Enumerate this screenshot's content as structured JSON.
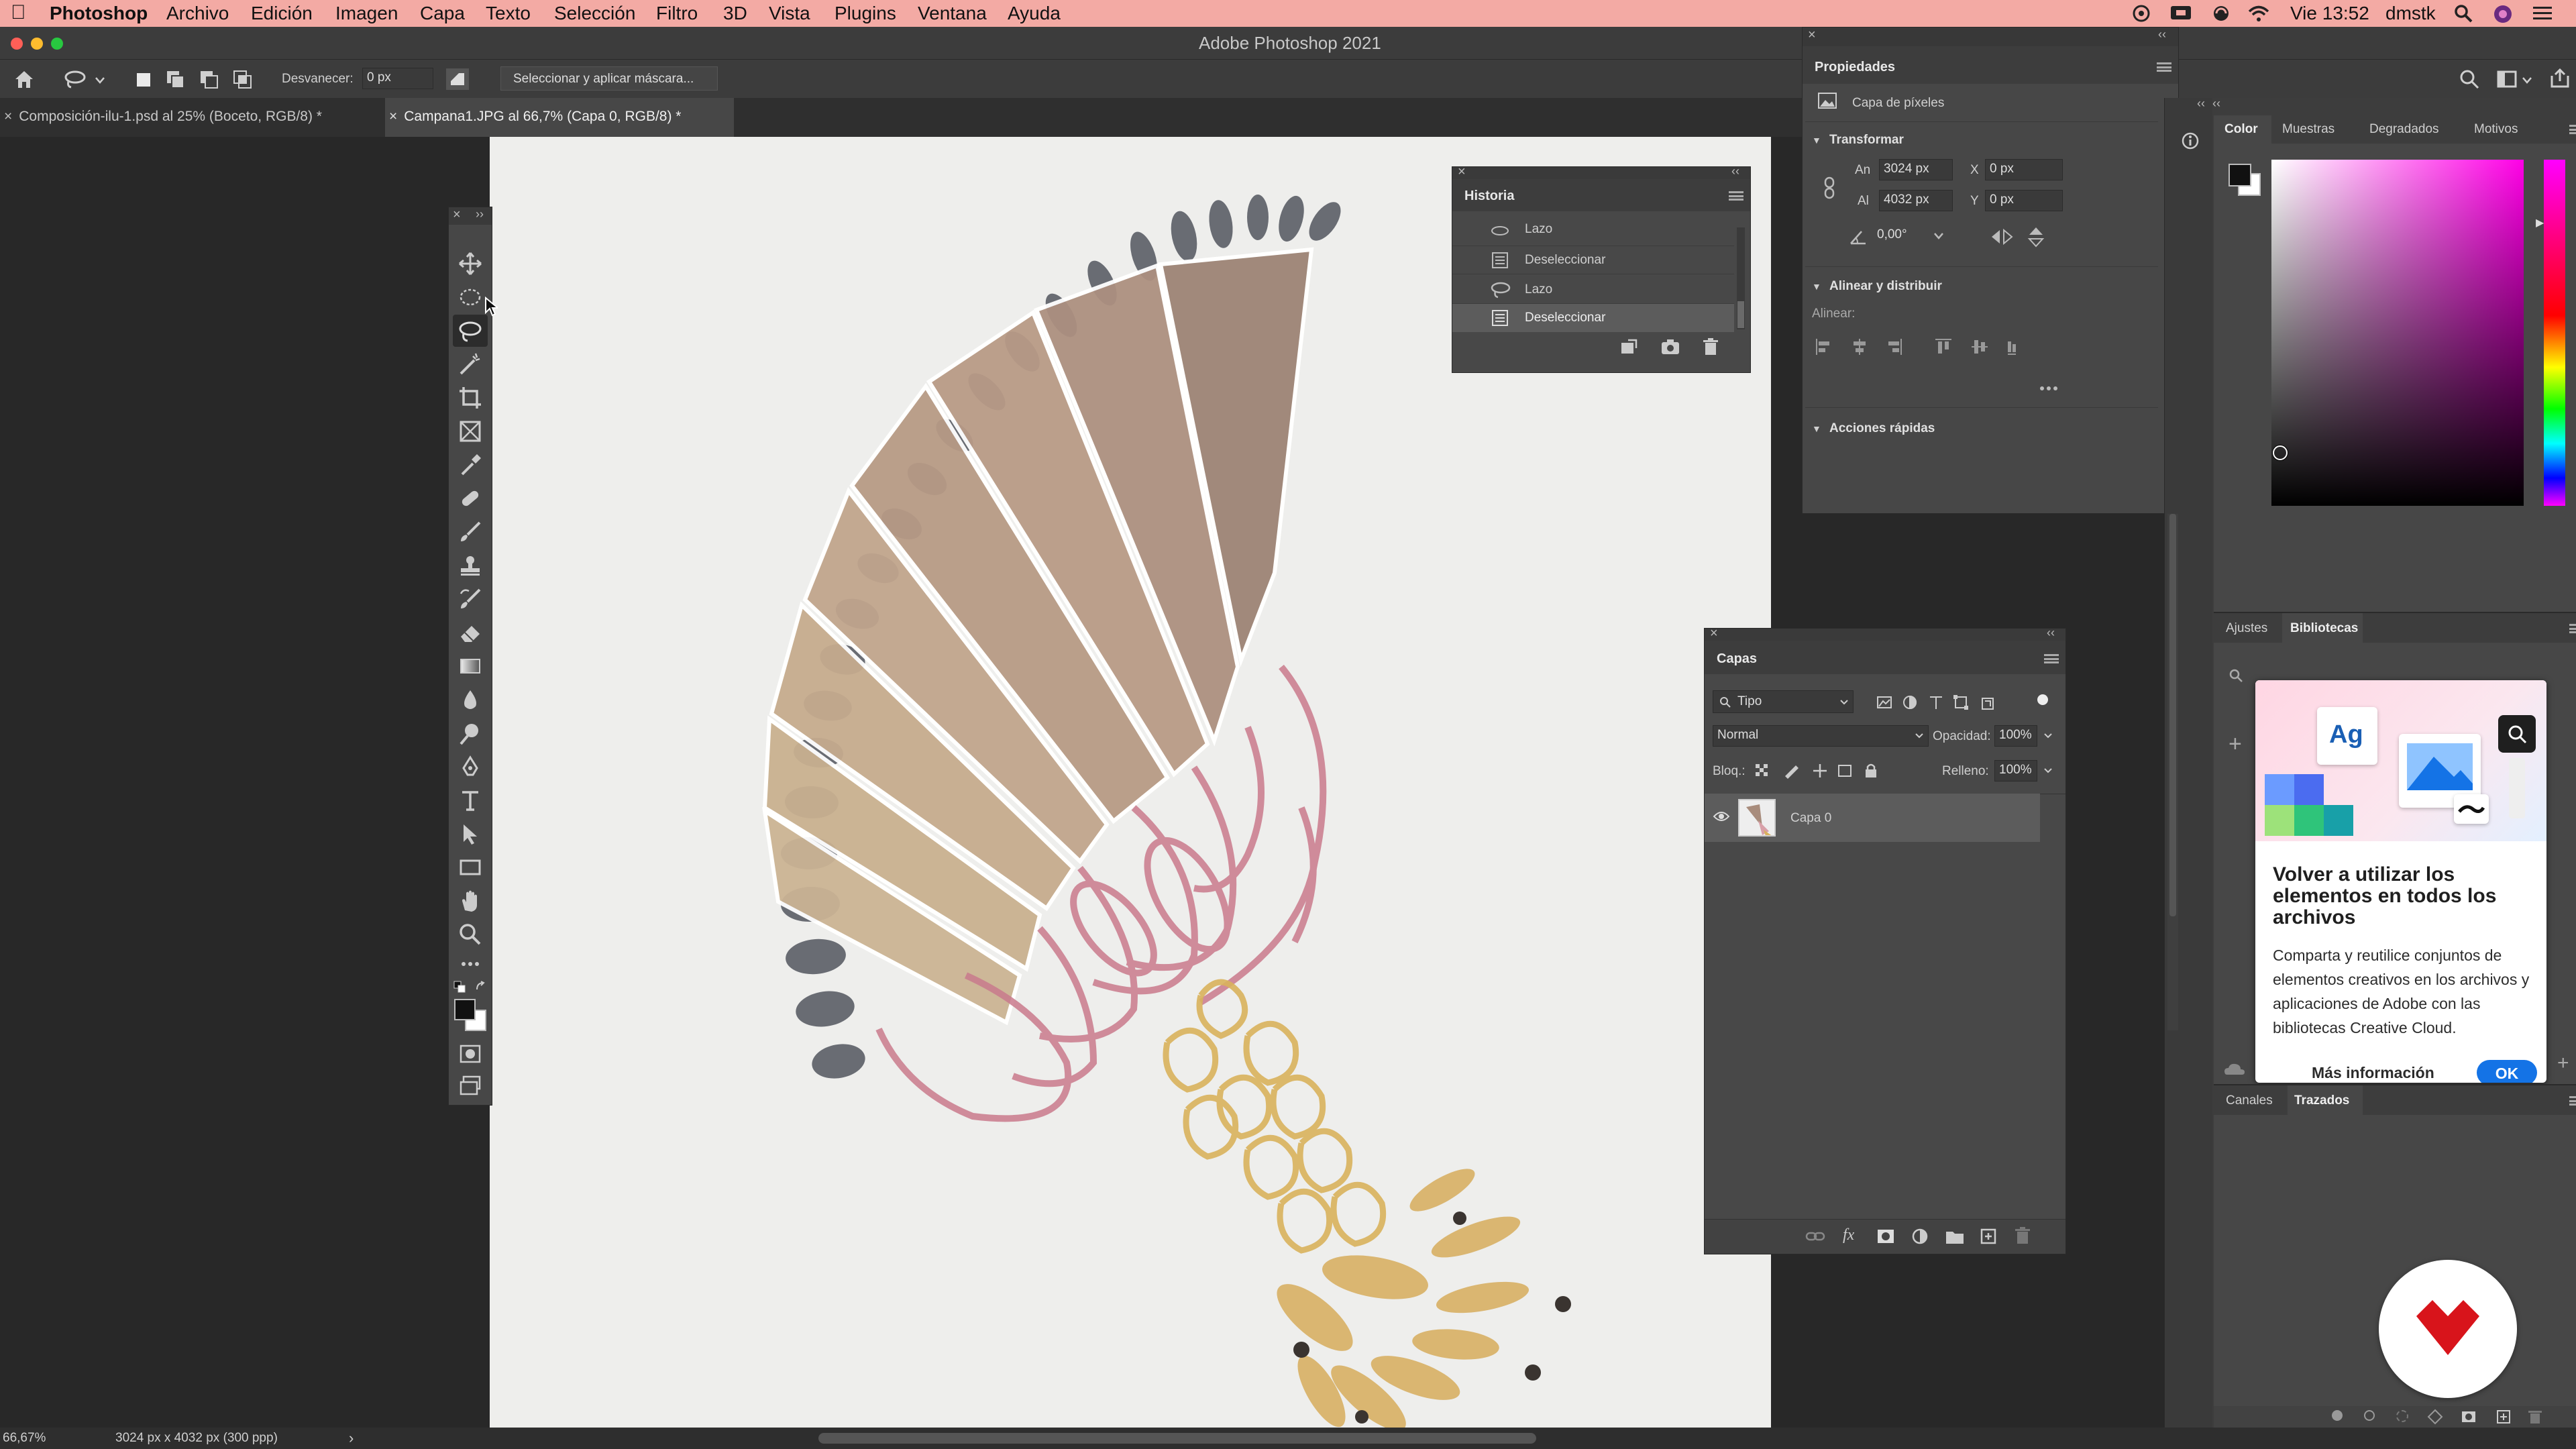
{
  "menubar": {
    "app_name": "Photoshop",
    "items": [
      "Archivo",
      "Edición",
      "Imagen",
      "Capa",
      "Texto",
      "Selección",
      "Filtro",
      "3D",
      "Vista",
      "Plugins",
      "Ventana",
      "Ayuda"
    ],
    "clock": "Vie 13:52",
    "user": "dmstk"
  },
  "window": {
    "title": "Adobe Photoshop 2021"
  },
  "options": {
    "feather_label": "Desvanecer:",
    "feather_value": "0 px",
    "select_mask_label": "Seleccionar y aplicar máscara..."
  },
  "tabs": [
    {
      "label": "Composición-ilu-1.psd al 25% (Boceto, RGB/8) *",
      "active": false
    },
    {
      "label": "Campana1.JPG al 66,7% (Capa 0, RGB/8) *",
      "active": true
    }
  ],
  "status": {
    "zoom": "66,67%",
    "doc_info": "3024 px x 4032 px (300 ppp)"
  },
  "historia": {
    "title": "Historia",
    "items": [
      "Lazo",
      "Deseleccionar",
      "Lazo",
      "Deseleccionar"
    ],
    "selected_index": 3
  },
  "properties": {
    "title": "Propiedades",
    "kind": "Capa de píxeles",
    "transform_header": "Transformar",
    "w_label": "An",
    "w_value": "3024 px",
    "h_label": "Al",
    "h_value": "4032 px",
    "x_label": "X",
    "x_value": "0 px",
    "y_label": "Y",
    "y_value": "0 px",
    "angle_value": "0,00°",
    "align_header": "Alinear y distribuir",
    "align_label": "Alinear:",
    "quick_header": "Acciones rápidas"
  },
  "color_panel": {
    "tabs": [
      "Color",
      "Muestras",
      "Degradados",
      "Motivos"
    ],
    "active_tab": "Color"
  },
  "libraries_panel": {
    "tabs": [
      "Ajustes",
      "Bibliotecas"
    ],
    "active_tab": "Bibliotecas",
    "card_title": "Volver a utilizar los elementos en todos los archivos",
    "card_body": "Comparta y reutilice conjuntos de elementos creativos en los archivos y aplicaciones de Adobe con las bibliotecas Creative Cloud.",
    "more_info": "Más información",
    "ok_label": "OK",
    "tile_label": "Ag"
  },
  "channels_panel": {
    "tabs": [
      "Canales",
      "Trazados"
    ],
    "active_tab": "Trazados"
  },
  "layers": {
    "title": "Capas",
    "filter_value": "Tipo",
    "blend_mode": "Normal",
    "opacity_label": "Opacidad:",
    "opacity_value": "100%",
    "lock_label": "Bloq.:",
    "fill_label": "Relleno:",
    "fill_value": "100%",
    "items": [
      {
        "name": "Capa 0",
        "visible": true
      }
    ]
  },
  "colors": {
    "menubar_bg": "#f3aaa4",
    "panel_bg": "#484848",
    "selection_bg": "#5c5c5c",
    "accent_blue": "#1473e6"
  }
}
